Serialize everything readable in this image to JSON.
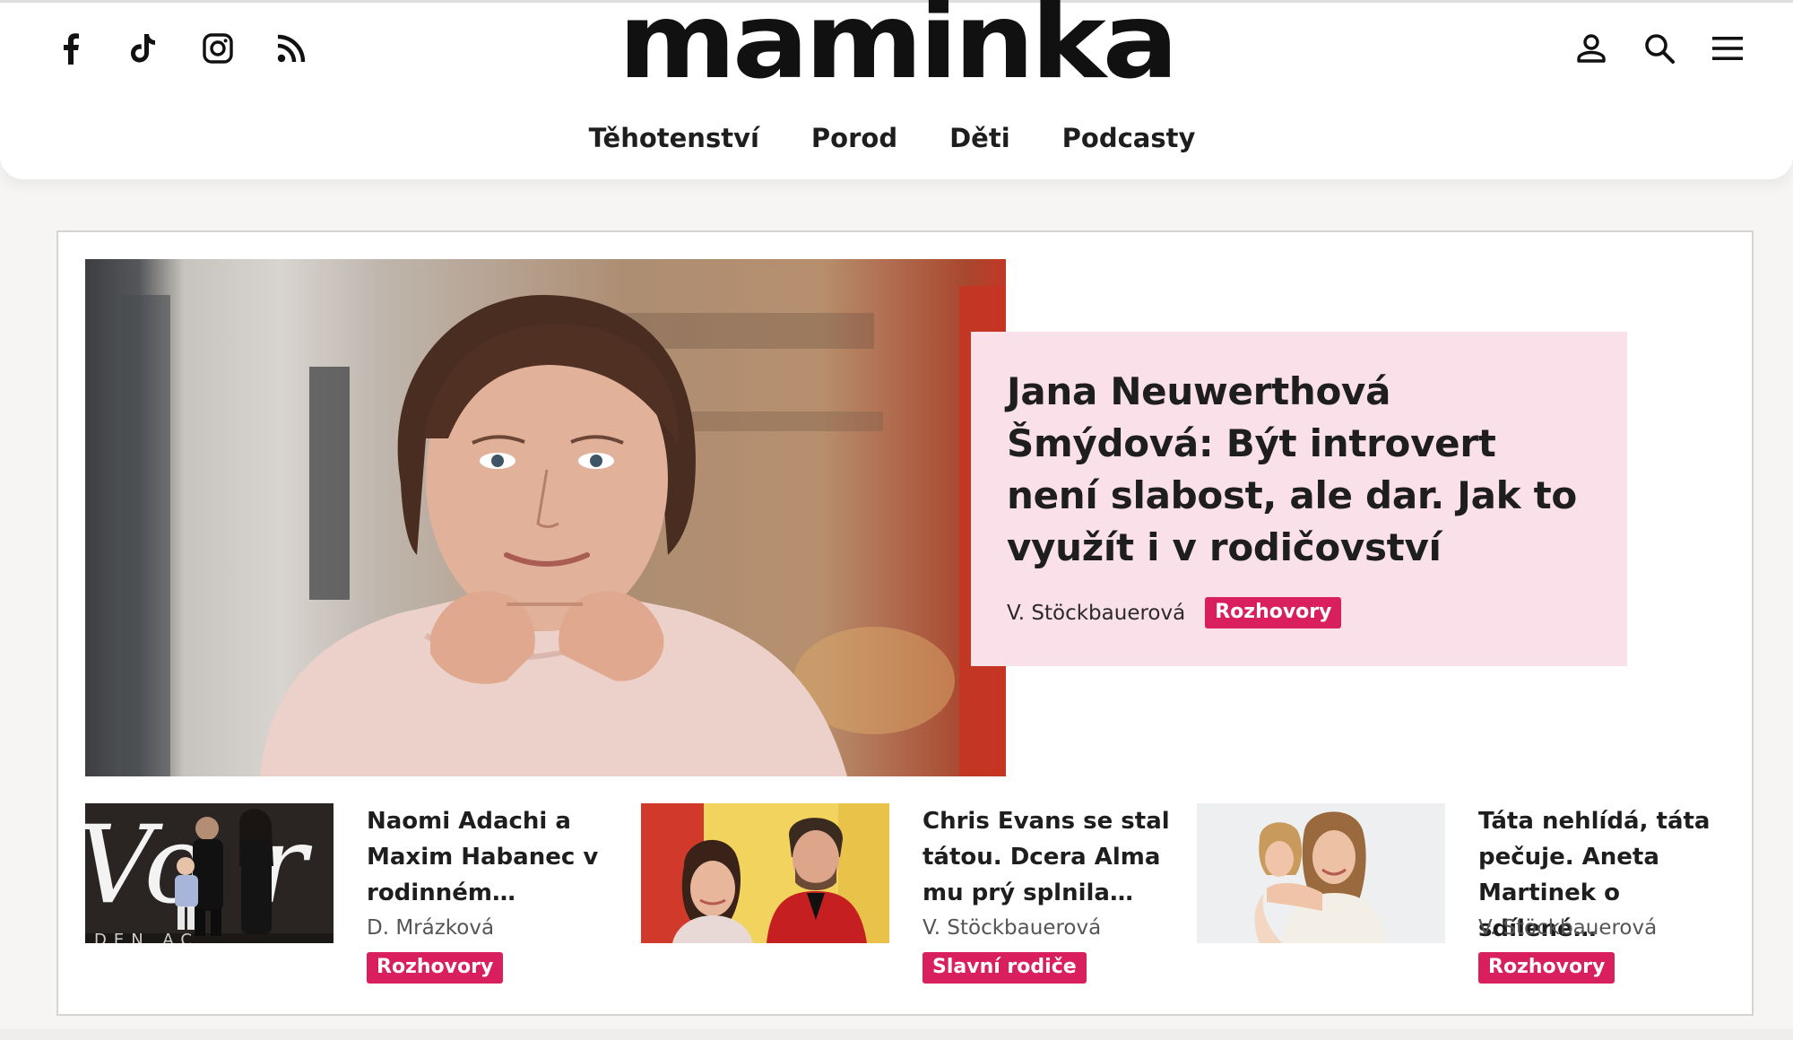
{
  "header": {
    "logo": "maminka",
    "social": [
      {
        "icon": "facebook-icon"
      },
      {
        "icon": "tiktok-icon"
      },
      {
        "icon": "instagram-icon"
      },
      {
        "icon": "rss-icon"
      }
    ],
    "tools": [
      {
        "icon": "user-icon"
      },
      {
        "icon": "search-icon"
      },
      {
        "icon": "menu-icon"
      }
    ],
    "nav": [
      "Těhotenství",
      "Porod",
      "Děti",
      "Podcasty"
    ]
  },
  "hero": {
    "title": "Jana Neuwerthová Šmýdová: Být introvert není slabost, ale dar. Jak to využít i v rodičovství",
    "author": "V. Stöckbauerová",
    "tag": "Rozhovory"
  },
  "articles": [
    {
      "title": "Naomi Adachi a Maxim Habanec v rodinném…",
      "author": "D. Mrázková",
      "tag": "Rozhovory"
    },
    {
      "title": "Chris Evans se stal tátou. Dcera Alma mu prý splnila…",
      "author": "V. Stöckbauerová",
      "tag": "Slavní rodiče"
    },
    {
      "title": "Táta nehlídá, táta pečuje. Aneta Martinek o sdílené…",
      "author": "V. Stöckbauerová",
      "tag": "Rozhovory"
    }
  ],
  "colors": {
    "accent": "#d91f5e",
    "hero_box": "#fae0e8",
    "text": "#1e1e1e"
  }
}
